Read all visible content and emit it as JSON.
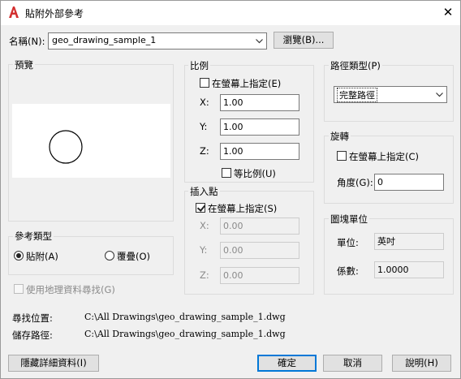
{
  "window": {
    "title": "貼附外部參考",
    "close_glyph": "✕",
    "app_icon": "autocad-a-icon",
    "accent": "#d32f2f"
  },
  "name_row": {
    "label": "名稱(N):",
    "value": "geo_drawing_sample_1",
    "browse_button": "瀏覽(B)..."
  },
  "preview": {
    "label": "預覽"
  },
  "scale": {
    "label": "比例",
    "specify_on_screen": "在螢幕上指定(E)",
    "specify_checked": false,
    "x_label": "X:",
    "x_value": "1.00",
    "y_label": "Y:",
    "y_value": "1.00",
    "z_label": "Z:",
    "z_value": "1.00",
    "uniform_label": "等比例(U)",
    "uniform_checked": false
  },
  "insertion": {
    "label": "插入點",
    "specify_on_screen": "在螢幕上指定(S)",
    "specify_checked": true,
    "x_label": "X:",
    "x_value": "0.00",
    "y_label": "Y:",
    "y_value": "0.00",
    "z_label": "Z:",
    "z_value": "0.00"
  },
  "path_type": {
    "label": "路徑類型(P)",
    "value": "完整路徑"
  },
  "rotation": {
    "label": "旋轉",
    "specify_on_screen": "在螢幕上指定(C)",
    "specify_checked": false,
    "angle_label": "角度(G):",
    "angle_value": "0"
  },
  "block_unit": {
    "label": "圖塊單位",
    "unit_label": "單位:",
    "unit_value": "英吋",
    "factor_label": "係數:",
    "factor_value": "1.0000"
  },
  "reference_type": {
    "label": "參考類型",
    "attach_label": "貼附(A)",
    "overlay_label": "覆疊(O)",
    "selected": "attach"
  },
  "geo_option": {
    "label": "使用地理資料尋找(G)",
    "checked": false
  },
  "paths": {
    "found_label": "尋找位置:",
    "found_value": "C:\\All Drawings\\geo_drawing_sample_1.dwg",
    "saved_label": "儲存路徑:",
    "saved_value": "C:\\All Drawings\\geo_drawing_sample_1.dwg"
  },
  "buttons": {
    "hide_details": "隱藏詳細資料(I)",
    "ok": "確定",
    "cancel": "取消",
    "help": "說明(H)"
  }
}
